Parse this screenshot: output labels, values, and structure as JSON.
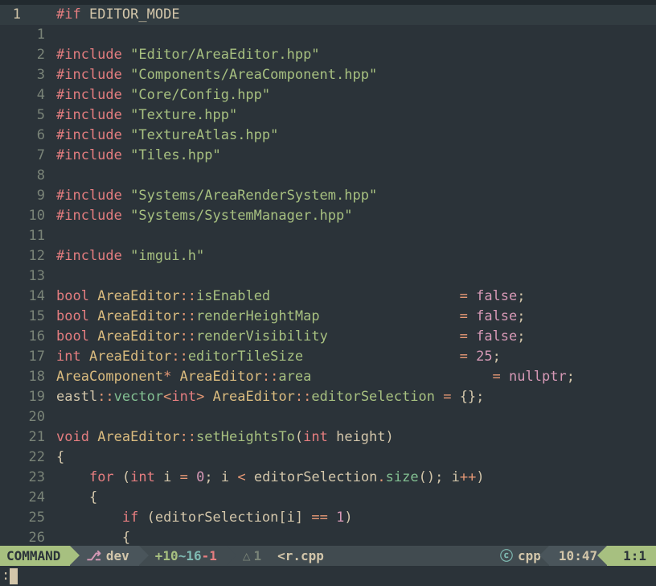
{
  "lines": [
    {
      "a": "1",
      "b": "",
      "cursor": true,
      "tokens": [
        {
          "t": "#if",
          "c": "kw-red"
        },
        {
          "t": " ",
          "c": "ident"
        },
        {
          "t": "EDITOR_MODE",
          "c": "macro"
        }
      ]
    },
    {
      "a": "",
      "b": "1",
      "tokens": []
    },
    {
      "a": "",
      "b": "2",
      "tokens": [
        {
          "t": "#include",
          "c": "kw-red"
        },
        {
          "t": " ",
          "c": "ident"
        },
        {
          "t": "\"Editor/AreaEditor.hpp\"",
          "c": "str"
        }
      ]
    },
    {
      "a": "",
      "b": "3",
      "tokens": [
        {
          "t": "#include",
          "c": "kw-red"
        },
        {
          "t": " ",
          "c": "ident"
        },
        {
          "t": "\"Components/AreaComponent.hpp\"",
          "c": "str"
        }
      ]
    },
    {
      "a": "",
      "b": "4",
      "tokens": [
        {
          "t": "#include",
          "c": "kw-red"
        },
        {
          "t": " ",
          "c": "ident"
        },
        {
          "t": "\"Core/Config.hpp\"",
          "c": "str"
        }
      ]
    },
    {
      "a": "",
      "b": "5",
      "tokens": [
        {
          "t": "#include",
          "c": "kw-red"
        },
        {
          "t": " ",
          "c": "ident"
        },
        {
          "t": "\"Texture.hpp\"",
          "c": "str"
        }
      ]
    },
    {
      "a": "",
      "b": "6",
      "tokens": [
        {
          "t": "#include",
          "c": "kw-red"
        },
        {
          "t": " ",
          "c": "ident"
        },
        {
          "t": "\"TextureAtlas.hpp\"",
          "c": "str"
        }
      ]
    },
    {
      "a": "",
      "b": "7",
      "tokens": [
        {
          "t": "#include",
          "c": "kw-red"
        },
        {
          "t": " ",
          "c": "ident"
        },
        {
          "t": "\"Tiles.hpp\"",
          "c": "str"
        }
      ]
    },
    {
      "a": "",
      "b": "8",
      "tokens": []
    },
    {
      "a": "",
      "b": "9",
      "tokens": [
        {
          "t": "#include",
          "c": "kw-red"
        },
        {
          "t": " ",
          "c": "ident"
        },
        {
          "t": "\"Systems/AreaRenderSystem.hpp\"",
          "c": "str"
        }
      ]
    },
    {
      "a": "",
      "b": "10",
      "tokens": [
        {
          "t": "#include",
          "c": "kw-red"
        },
        {
          "t": " ",
          "c": "ident"
        },
        {
          "t": "\"Systems/SystemManager.hpp\"",
          "c": "str"
        }
      ]
    },
    {
      "a": "",
      "b": "11",
      "tokens": []
    },
    {
      "a": "",
      "b": "12",
      "tokens": [
        {
          "t": "#include",
          "c": "kw-red"
        },
        {
          "t": " ",
          "c": "ident"
        },
        {
          "t": "\"imgui.h\"",
          "c": "str"
        }
      ]
    },
    {
      "a": "",
      "b": "13",
      "tokens": []
    },
    {
      "a": "",
      "b": "14",
      "tokens": [
        {
          "t": "bool",
          "c": "kw-red"
        },
        {
          "t": " ",
          "c": "ident"
        },
        {
          "t": "AreaEditor",
          "c": "type"
        },
        {
          "t": "::",
          "c": "op"
        },
        {
          "t": "isEnabled",
          "c": "fn"
        },
        {
          "t": "                       ",
          "c": "ident"
        },
        {
          "t": "=",
          "c": "op"
        },
        {
          "t": " ",
          "c": "ident"
        },
        {
          "t": "false",
          "c": "const"
        },
        {
          "t": ";",
          "c": "punc"
        }
      ]
    },
    {
      "a": "",
      "b": "15",
      "tokens": [
        {
          "t": "bool",
          "c": "kw-red"
        },
        {
          "t": " ",
          "c": "ident"
        },
        {
          "t": "AreaEditor",
          "c": "type"
        },
        {
          "t": "::",
          "c": "op"
        },
        {
          "t": "renderHeightMap",
          "c": "fn"
        },
        {
          "t": "                 ",
          "c": "ident"
        },
        {
          "t": "=",
          "c": "op"
        },
        {
          "t": " ",
          "c": "ident"
        },
        {
          "t": "false",
          "c": "const"
        },
        {
          "t": ";",
          "c": "punc"
        }
      ]
    },
    {
      "a": "",
      "b": "16",
      "tokens": [
        {
          "t": "bool",
          "c": "kw-red"
        },
        {
          "t": " ",
          "c": "ident"
        },
        {
          "t": "AreaEditor",
          "c": "type"
        },
        {
          "t": "::",
          "c": "op"
        },
        {
          "t": "renderVisibility",
          "c": "fn"
        },
        {
          "t": "                ",
          "c": "ident"
        },
        {
          "t": "=",
          "c": "op"
        },
        {
          "t": " ",
          "c": "ident"
        },
        {
          "t": "false",
          "c": "const"
        },
        {
          "t": ";",
          "c": "punc"
        }
      ]
    },
    {
      "a": "",
      "b": "17",
      "tokens": [
        {
          "t": "int",
          "c": "kw-red"
        },
        {
          "t": " ",
          "c": "ident"
        },
        {
          "t": "AreaEditor",
          "c": "type"
        },
        {
          "t": "::",
          "c": "op"
        },
        {
          "t": "editorTileSize",
          "c": "fn"
        },
        {
          "t": "                   ",
          "c": "ident"
        },
        {
          "t": "=",
          "c": "op"
        },
        {
          "t": " ",
          "c": "ident"
        },
        {
          "t": "25",
          "c": "num"
        },
        {
          "t": ";",
          "c": "punc"
        }
      ]
    },
    {
      "a": "",
      "b": "18",
      "tokens": [
        {
          "t": "AreaComponent",
          "c": "type"
        },
        {
          "t": "*",
          "c": "op"
        },
        {
          "t": " ",
          "c": "ident"
        },
        {
          "t": "AreaEditor",
          "c": "type"
        },
        {
          "t": "::",
          "c": "op"
        },
        {
          "t": "area",
          "c": "fn"
        },
        {
          "t": "                      ",
          "c": "ident"
        },
        {
          "t": "=",
          "c": "op"
        },
        {
          "t": " ",
          "c": "ident"
        },
        {
          "t": "nullptr",
          "c": "const"
        },
        {
          "t": ";",
          "c": "punc"
        }
      ]
    },
    {
      "a": "",
      "b": "19",
      "tokens": [
        {
          "t": "eastl",
          "c": "ident"
        },
        {
          "t": "::",
          "c": "op"
        },
        {
          "t": "vector",
          "c": "aqua"
        },
        {
          "t": "<",
          "c": "op"
        },
        {
          "t": "int",
          "c": "kw-red"
        },
        {
          "t": ">",
          "c": "op"
        },
        {
          "t": " ",
          "c": "ident"
        },
        {
          "t": "AreaEditor",
          "c": "type"
        },
        {
          "t": "::",
          "c": "op"
        },
        {
          "t": "editorSelection",
          "c": "fn"
        },
        {
          "t": " ",
          "c": "ident"
        },
        {
          "t": "=",
          "c": "op"
        },
        {
          "t": " ",
          "c": "ident"
        },
        {
          "t": "{}",
          "c": "punc"
        },
        {
          "t": ";",
          "c": "punc"
        }
      ]
    },
    {
      "a": "",
      "b": "20",
      "tokens": []
    },
    {
      "a": "",
      "b": "21",
      "tokens": [
        {
          "t": "void",
          "c": "kw-red"
        },
        {
          "t": " ",
          "c": "ident"
        },
        {
          "t": "AreaEditor",
          "c": "type"
        },
        {
          "t": "::",
          "c": "op"
        },
        {
          "t": "setHeightsTo",
          "c": "fn"
        },
        {
          "t": "(",
          "c": "punc"
        },
        {
          "t": "int",
          "c": "kw-red"
        },
        {
          "t": " ",
          "c": "ident"
        },
        {
          "t": "height",
          "c": "ident"
        },
        {
          "t": ")",
          "c": "punc"
        }
      ]
    },
    {
      "a": "",
      "b": "22",
      "tokens": [
        {
          "t": "{",
          "c": "punc"
        }
      ]
    },
    {
      "a": "",
      "b": "23",
      "tokens": [
        {
          "t": "    ",
          "c": "ident"
        },
        {
          "t": "for",
          "c": "kw-red"
        },
        {
          "t": " ",
          "c": "ident"
        },
        {
          "t": "(",
          "c": "punc"
        },
        {
          "t": "int",
          "c": "kw-red"
        },
        {
          "t": " ",
          "c": "ident"
        },
        {
          "t": "i",
          "c": "ident"
        },
        {
          "t": " ",
          "c": "ident"
        },
        {
          "t": "=",
          "c": "op"
        },
        {
          "t": " ",
          "c": "ident"
        },
        {
          "t": "0",
          "c": "num"
        },
        {
          "t": ";",
          "c": "punc"
        },
        {
          "t": " ",
          "c": "ident"
        },
        {
          "t": "i",
          "c": "ident"
        },
        {
          "t": " ",
          "c": "ident"
        },
        {
          "t": "<",
          "c": "op"
        },
        {
          "t": " ",
          "c": "ident"
        },
        {
          "t": "editorSelection",
          "c": "ident"
        },
        {
          "t": ".",
          "c": "op"
        },
        {
          "t": "size",
          "c": "aqua"
        },
        {
          "t": "()",
          "c": "punc"
        },
        {
          "t": ";",
          "c": "punc"
        },
        {
          "t": " ",
          "c": "ident"
        },
        {
          "t": "i",
          "c": "ident"
        },
        {
          "t": "++",
          "c": "op"
        },
        {
          "t": ")",
          "c": "punc"
        }
      ]
    },
    {
      "a": "",
      "b": "24",
      "tokens": [
        {
          "t": "    ",
          "c": "ident"
        },
        {
          "t": "{",
          "c": "punc"
        }
      ]
    },
    {
      "a": "",
      "b": "25",
      "tokens": [
        {
          "t": "        ",
          "c": "ident"
        },
        {
          "t": "if",
          "c": "kw-red"
        },
        {
          "t": " ",
          "c": "ident"
        },
        {
          "t": "(",
          "c": "punc"
        },
        {
          "t": "editorSelection",
          "c": "ident"
        },
        {
          "t": "[",
          "c": "punc"
        },
        {
          "t": "i",
          "c": "ident"
        },
        {
          "t": "]",
          "c": "punc"
        },
        {
          "t": " ",
          "c": "ident"
        },
        {
          "t": "==",
          "c": "op"
        },
        {
          "t": " ",
          "c": "ident"
        },
        {
          "t": "1",
          "c": "num"
        },
        {
          "t": ")",
          "c": "punc"
        }
      ]
    },
    {
      "a": "",
      "b": "26",
      "tokens": [
        {
          "t": "        ",
          "c": "ident"
        },
        {
          "t": "{",
          "c": "punc"
        }
      ]
    }
  ],
  "status": {
    "mode": "COMMAND",
    "branch": "dev",
    "git_add": "+10",
    "git_mod": "~16",
    "git_del": "-1",
    "diag_warn": "1",
    "filename": "<r.cpp",
    "filetype": "cpp",
    "clock": "10:47",
    "position": "1:1"
  },
  "cmdline": {
    "prompt": ":"
  }
}
